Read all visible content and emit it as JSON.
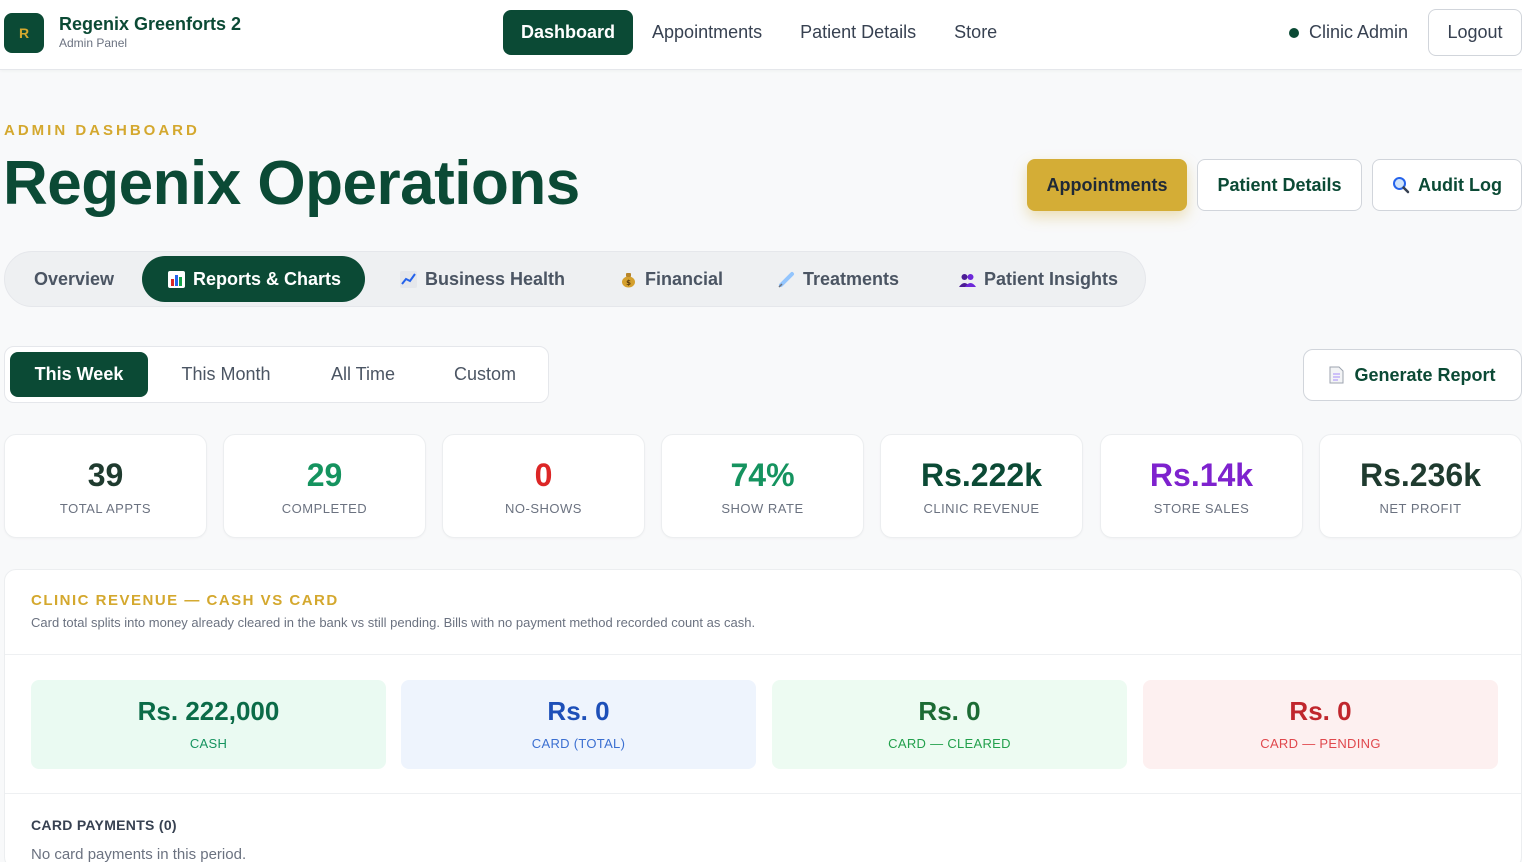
{
  "brand": {
    "badge": "R",
    "title": "Regenix Greenforts 2",
    "subtitle": "Admin Panel"
  },
  "nav": {
    "items": [
      "Dashboard",
      "Appointments",
      "Patient Details",
      "Store"
    ],
    "active": "Dashboard"
  },
  "user": {
    "name": "Clinic Admin",
    "logout_label": "Logout"
  },
  "header": {
    "eyebrow": "ADMIN DASHBOARD",
    "title": "Regenix Operations",
    "buttons": {
      "appointments": "Appointments",
      "patient_details": "Patient Details",
      "audit_log": "Audit Log"
    }
  },
  "tabs": {
    "overview": "Overview",
    "reports": "Reports & Charts",
    "business": "Business Health",
    "financial": "Financial",
    "treatments": "Treatments",
    "insights": "Patient Insights"
  },
  "period": {
    "week": "This Week",
    "month": "This Month",
    "all": "All Time",
    "custom": "Custom",
    "active": "This Week"
  },
  "generate_report": "Generate Report",
  "stats": [
    {
      "value": "39",
      "label": "TOTAL APPTS",
      "color": "#1f3b2f"
    },
    {
      "value": "29",
      "label": "COMPLETED",
      "color": "#15935f"
    },
    {
      "value": "0",
      "label": "NO-SHOWS",
      "color": "#dc2626"
    },
    {
      "value": "74%",
      "label": "SHOW RATE",
      "color": "#15935f"
    },
    {
      "value": "Rs.222k",
      "label": "CLINIC REVENUE",
      "color": "#0b4a35"
    },
    {
      "value": "Rs.14k",
      "label": "STORE SALES",
      "color": "#7e22ce"
    },
    {
      "value": "Rs.236k",
      "label": "NET PROFIT",
      "color": "#1f3b2f"
    }
  ],
  "revenue": {
    "title": "CLINIC REVENUE — CASH VS CARD",
    "description": "Card total splits into money already cleared in the bank vs still pending. Bills with no payment method recorded count as cash.",
    "cards": [
      {
        "value": "Rs. 222,000",
        "label": "CASH"
      },
      {
        "value": "Rs. 0",
        "label": "CARD (TOTAL)"
      },
      {
        "value": "Rs. 0",
        "label": "CARD — CLEARED"
      },
      {
        "value": "Rs. 0",
        "label": "CARD — PENDING"
      }
    ],
    "card_payments_title": "CARD PAYMENTS (0)",
    "card_payments_empty": "No card payments in this period."
  }
}
